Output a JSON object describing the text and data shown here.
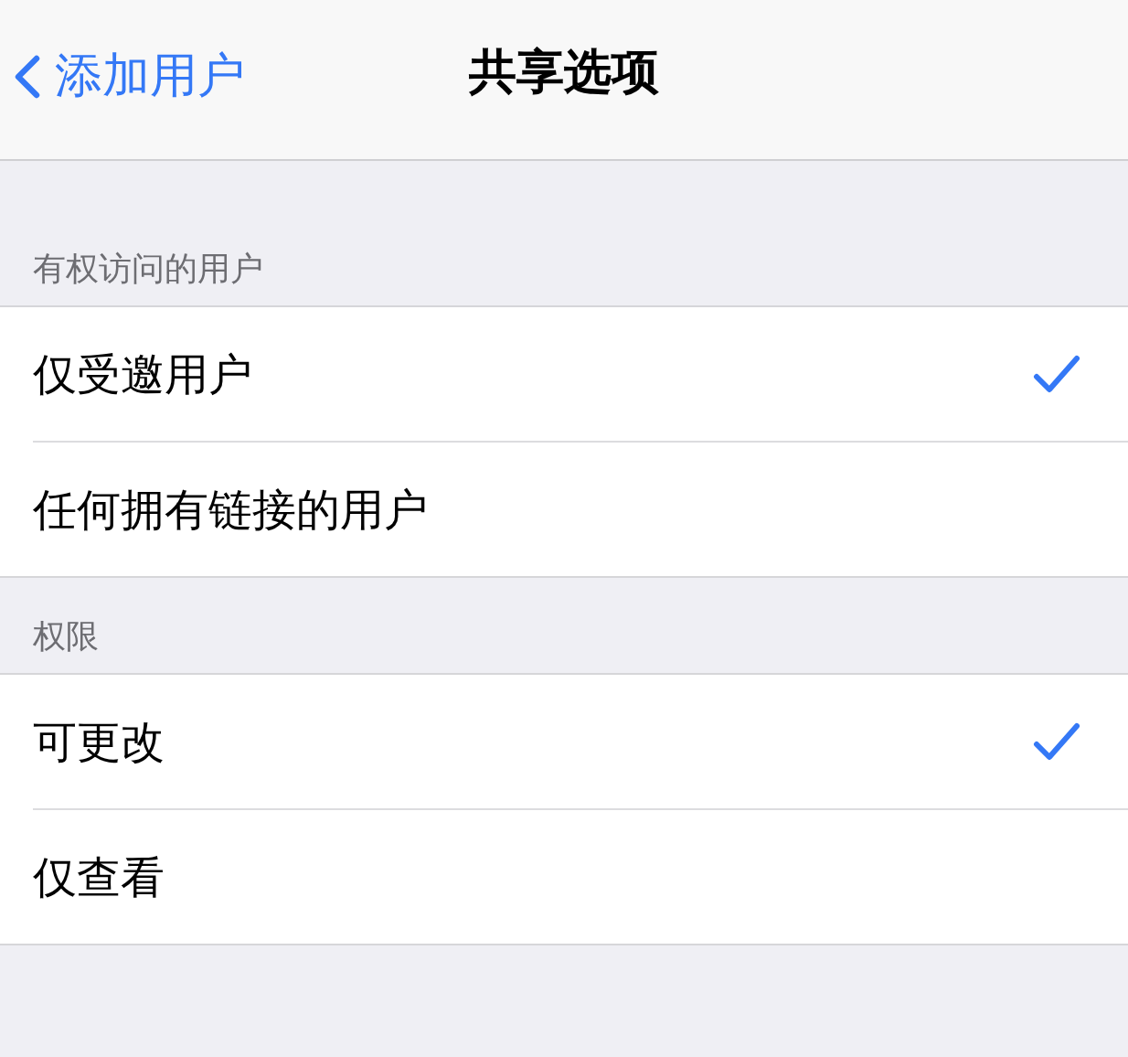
{
  "nav": {
    "back_label": "添加用户",
    "title": "共享选项"
  },
  "sections": [
    {
      "header": "有权访问的用户",
      "rows": [
        {
          "label": "仅受邀用户",
          "selected": true
        },
        {
          "label": "任何拥有链接的用户",
          "selected": false
        }
      ]
    },
    {
      "header": "权限",
      "rows": [
        {
          "label": "可更改",
          "selected": true
        },
        {
          "label": "仅查看",
          "selected": false
        }
      ]
    }
  ]
}
